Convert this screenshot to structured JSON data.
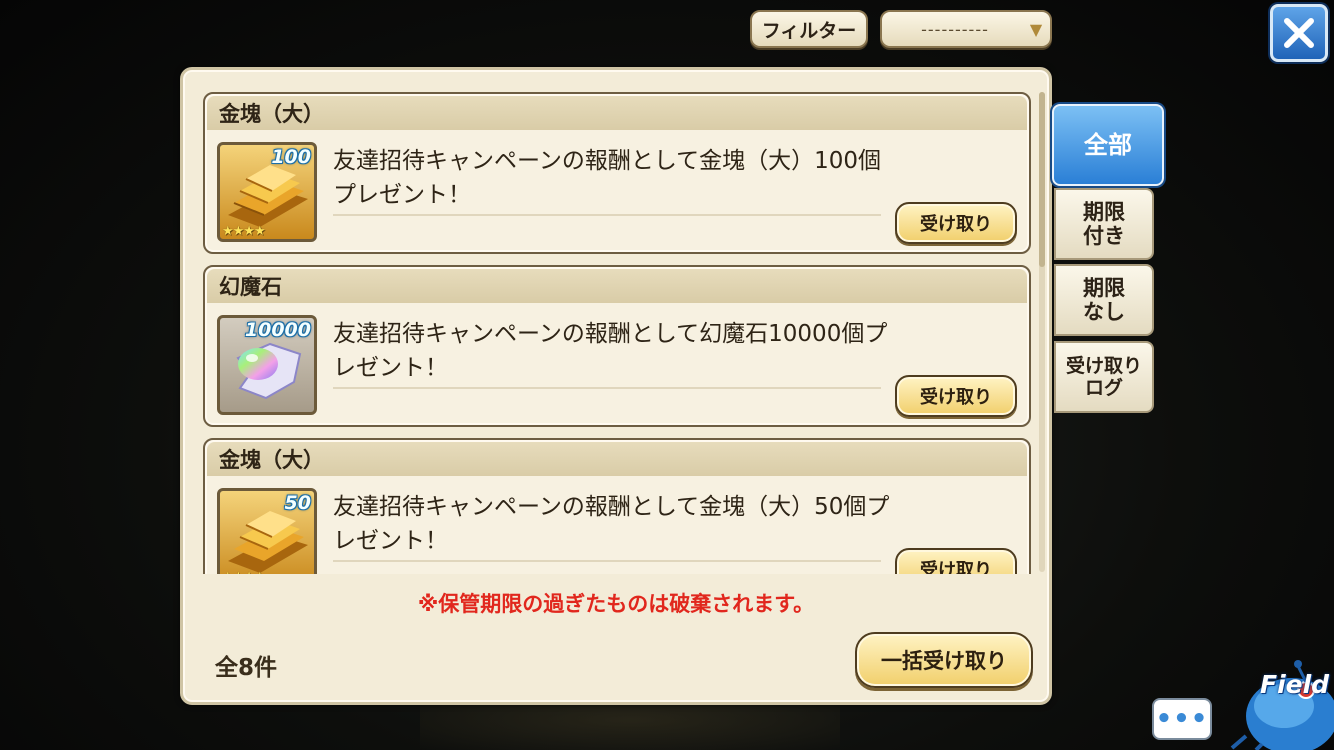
{
  "header": {
    "filter_label": "フィルター",
    "filter_value": "----------"
  },
  "items": [
    {
      "title": "金塊（大）",
      "quantity": "100",
      "rarity_stars": "★★★★",
      "description": "友達招待キャンペーンの報酬として金塊（大）100個プレゼント！",
      "button": "受け取り",
      "icon": "gold-bars-icon"
    },
    {
      "title": "幻魔石",
      "quantity": "10000",
      "description": "友達招待キャンペーンの報酬として幻魔石10000個プレゼント！",
      "button": "受け取り",
      "icon": "rainbow-stone-icon"
    },
    {
      "title": "金塊（大）",
      "quantity": "50",
      "rarity_stars": "★★★★",
      "description": "友達招待キャンペーンの報酬として金塊（大）50個プレゼント！",
      "button": "受け取り",
      "icon": "gold-bars-icon"
    }
  ],
  "notice": "※保管期限の過ぎたものは破棄されます。",
  "total": "全8件",
  "bulk_receive": "一括受け取り",
  "tabs": [
    {
      "label": "全部",
      "active": true
    },
    {
      "label": "期限\n付き",
      "active": false
    },
    {
      "label": "期限\nなし",
      "active": false
    },
    {
      "label": "受け取り\nログ",
      "active": false
    }
  ],
  "widgets": {
    "chat_label": "•••",
    "field_label": "Field"
  },
  "colors": {
    "accent_blue": "#2a7fd6",
    "notice_red": "#e1271d",
    "button_gold": "#f1cf6b",
    "panel_bg": "#f3ecd8"
  }
}
